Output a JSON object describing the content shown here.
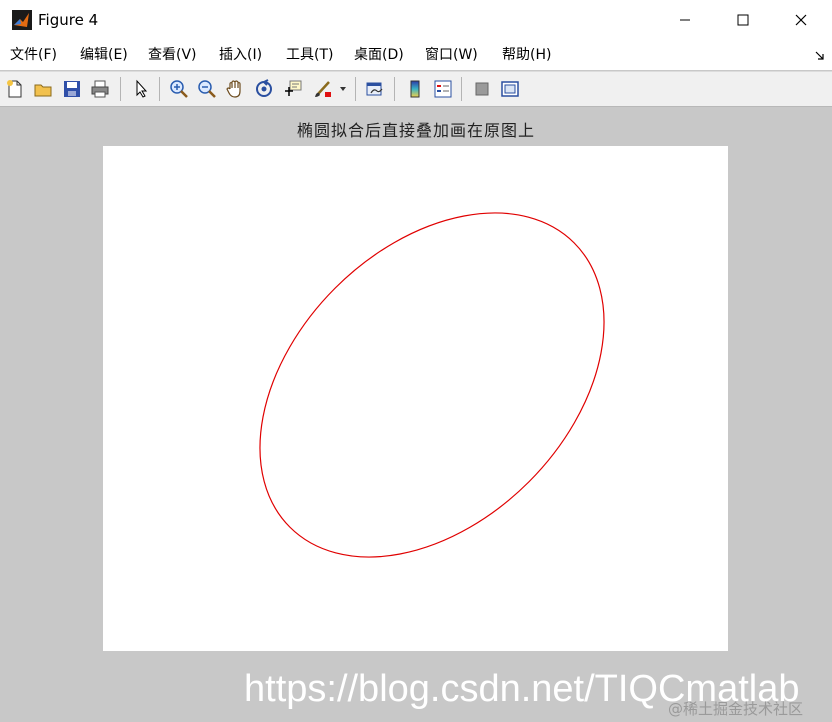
{
  "window": {
    "title": "Figure 4"
  },
  "menu": [
    {
      "label": "文件(F)"
    },
    {
      "label": "编辑(E)"
    },
    {
      "label": "查看(V)"
    },
    {
      "label": "插入(I)"
    },
    {
      "label": "工具(T)"
    },
    {
      "label": "桌面(D)"
    },
    {
      "label": "窗口(W)"
    },
    {
      "label": "帮助(H)"
    }
  ],
  "toolbar": [
    {
      "icon": "new-file-icon"
    },
    {
      "icon": "open-folder-icon"
    },
    {
      "icon": "save-icon"
    },
    {
      "icon": "print-icon"
    },
    {
      "icon": "pointer-icon"
    },
    {
      "icon": "zoom-in-icon"
    },
    {
      "icon": "zoom-out-icon"
    },
    {
      "icon": "pan-hand-icon"
    },
    {
      "icon": "rotate-3d-icon"
    },
    {
      "icon": "data-cursor-icon"
    },
    {
      "icon": "brush-icon"
    },
    {
      "icon": "link-plot-icon"
    },
    {
      "icon": "colorbar-icon"
    },
    {
      "icon": "legend-icon"
    },
    {
      "icon": "hide-plot-tools-icon"
    },
    {
      "icon": "show-plot-tools-icon"
    }
  ],
  "figure": {
    "title": "椭圆拟合后直接叠加画在原图上",
    "curve_color": "#e00000",
    "background": "#ffffff"
  },
  "watermark": {
    "main": "https://blog.csdn.net/TIQCmatlab",
    "secondary": "@稀土掘金技术社区"
  },
  "colors": {
    "figure_bg": "#c8c8c8",
    "toolbar_bg": "#f0f0f0"
  }
}
